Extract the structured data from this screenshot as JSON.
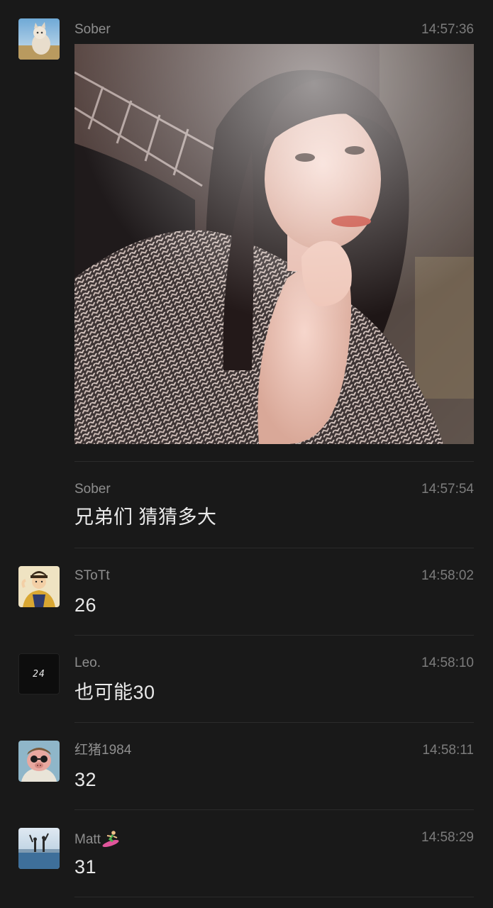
{
  "messages": [
    {
      "sender": "Sober",
      "time": "14:57:36",
      "type": "image",
      "avatar_icon": "cat-photo-avatar"
    },
    {
      "sender": "Sober",
      "time": "14:57:54",
      "type": "text",
      "text": "兄弟们 猜猜多大"
    },
    {
      "sender": "SToTt",
      "time": "14:58:02",
      "type": "text",
      "text": "26",
      "avatar_icon": "cartoon-emperor-avatar"
    },
    {
      "sender": "Leo.",
      "time": "14:58:10",
      "type": "text",
      "text": "也可能30",
      "avatar_icon": "digital-24-avatar",
      "avatar_text": "24"
    },
    {
      "sender": "红猪1984",
      "time": "14:58:11",
      "type": "text",
      "text": "32",
      "avatar_icon": "porco-rosso-avatar"
    },
    {
      "sender": "Matt",
      "sender_emoji": "surfer-emoji",
      "time": "14:58:29",
      "type": "text",
      "text": "31",
      "avatar_icon": "seaside-people-avatar"
    }
  ],
  "colors": {
    "background": "#191919",
    "sender": "#8e8e8e",
    "time": "#7c7c7c",
    "text": "#e9e9e9",
    "divider": "#2b2b2b"
  }
}
